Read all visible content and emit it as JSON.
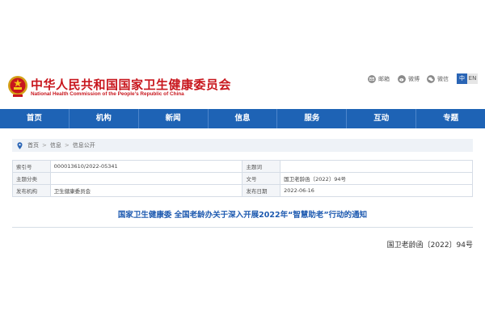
{
  "site": {
    "title_cn": "中华人民共和国国家卫生健康委员会",
    "title_en": "National Health Commission of the People’s Republic of China"
  },
  "share": {
    "mail_label": "邮箱",
    "weibo_label": "微博",
    "wechat_label": "微信"
  },
  "lang": {
    "zh": "中",
    "en": "EN"
  },
  "nav": {
    "items": [
      {
        "label": "首页"
      },
      {
        "label": "机构"
      },
      {
        "label": "新闻"
      },
      {
        "label": "信息"
      },
      {
        "label": "服务"
      },
      {
        "label": "互动"
      },
      {
        "label": "专题"
      }
    ]
  },
  "breadcrumb": {
    "items": [
      "首页",
      "信息",
      "信息公开"
    ],
    "separator": ">"
  },
  "info_table": {
    "rows": [
      {
        "label1": "索引号",
        "value1": "000013610/2022-05341",
        "label2": "主题词",
        "value2": ""
      },
      {
        "label1": "主题分类",
        "value1": "",
        "label2": "文号",
        "value2": "国卫老龄函〔2022〕94号"
      },
      {
        "label1": "发布机构",
        "value1": "卫生健康委员会",
        "label2": "发布日期",
        "value2": "2022-06-16"
      }
    ]
  },
  "document": {
    "title": "国家卫生健康委 全国老龄办关于深入开展2022年“智慧助老”行动的通知",
    "number": "国卫老龄函〔2022〕94号"
  },
  "colors": {
    "brand_red": "#c8161d",
    "nav_blue": "#1e63b5",
    "title_blue": "#1e5ab0"
  }
}
